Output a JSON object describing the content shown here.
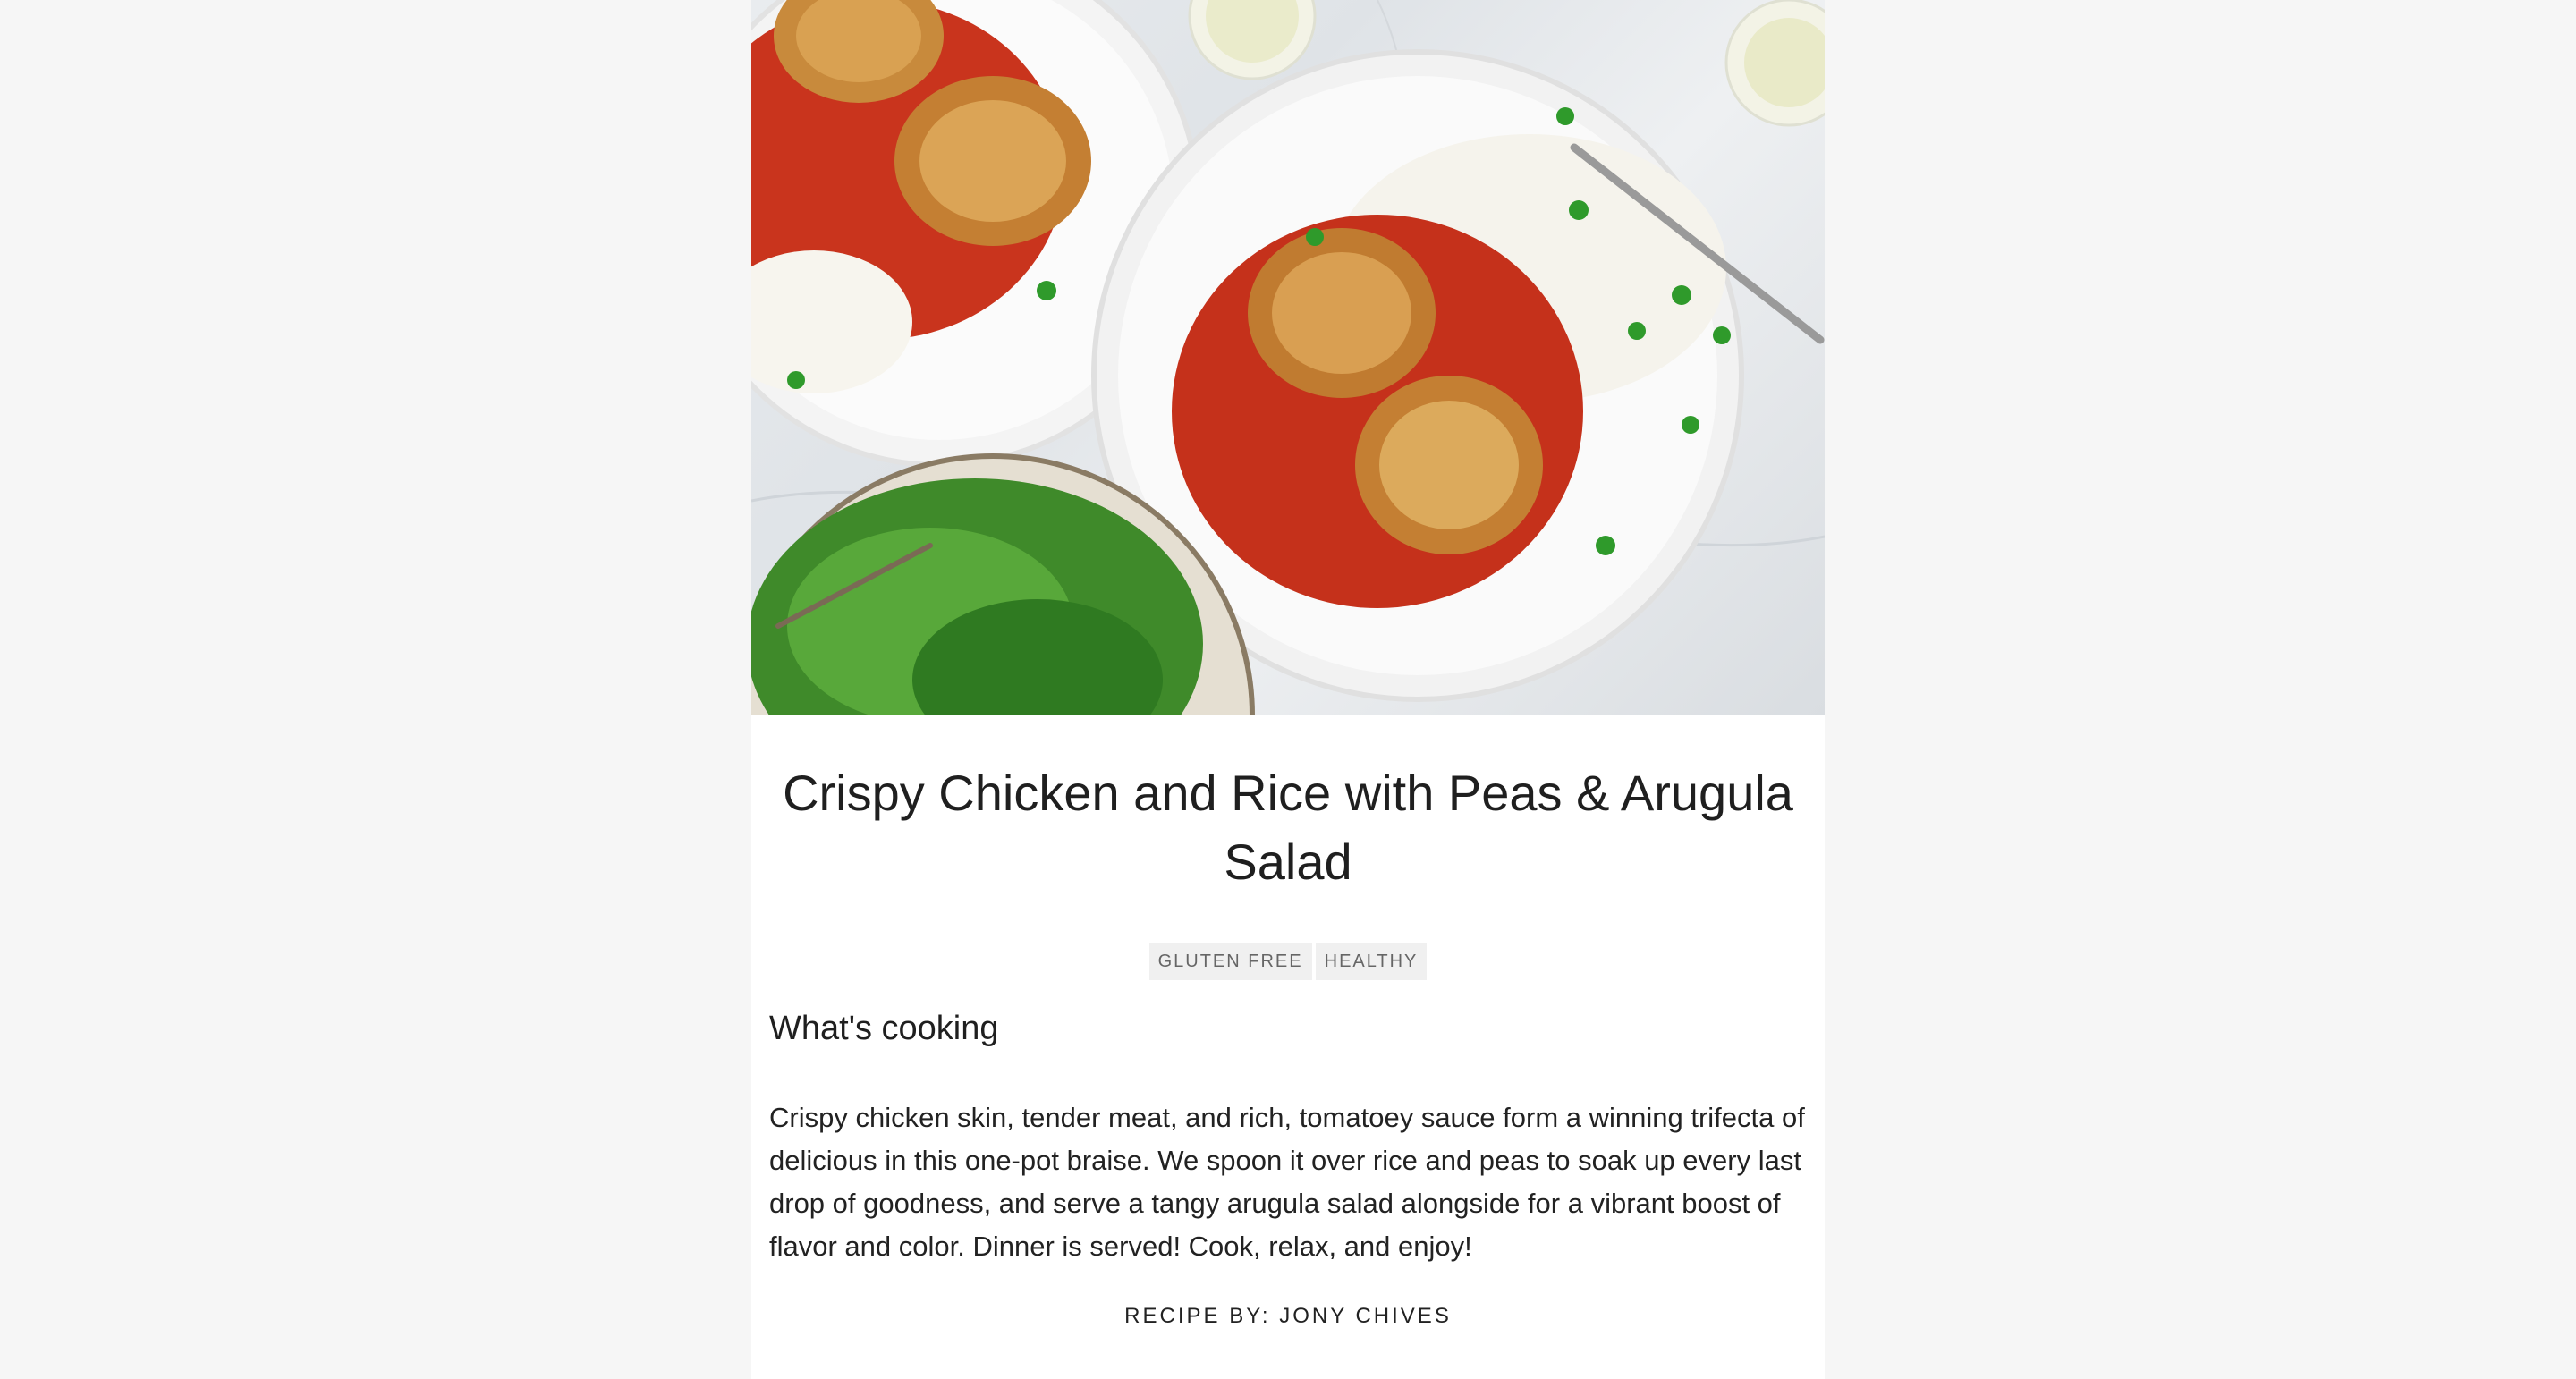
{
  "recipe": {
    "hero_image": "chicken-rice-plate-photo",
    "title": "Crispy Chicken and Rice with Peas & Arugula Salad",
    "tags": [
      "GLUTEN FREE",
      "HEALTHY"
    ],
    "section_title": "What's cooking",
    "description": "Crispy chicken skin, tender meat, and rich, tomatoey sauce form a winning trifecta of delicious in this one-pot braise. We spoon it over rice and peas to soak up every last drop of goodness, and serve a tangy arugula salad alongside for a vibrant boost of flavor and color. Dinner is served! Cook, relax, and enjoy!",
    "byline": "RECIPE BY: JONY CHIVES"
  },
  "colors": {
    "page_background": "#f6f6f6",
    "card_background": "#ffffff",
    "tag_background": "#f0f0f0"
  }
}
